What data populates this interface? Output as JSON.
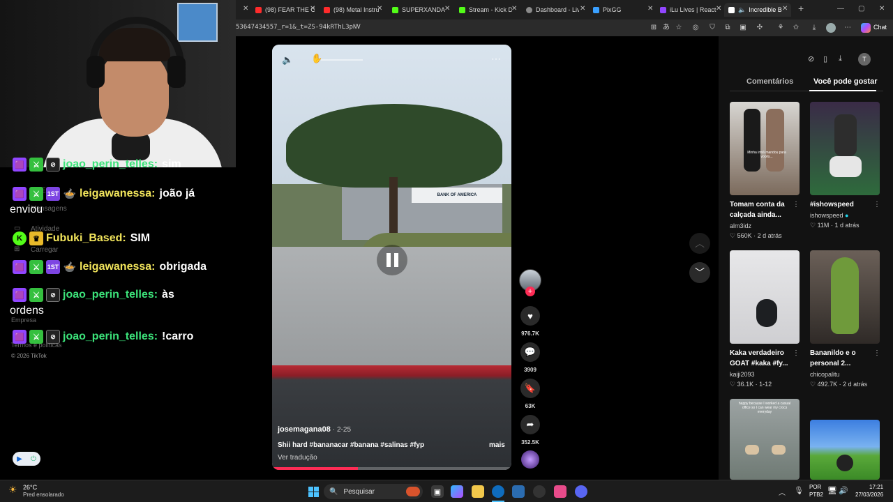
{
  "browser": {
    "tabs": [
      {
        "title": "(98) FEAR THE C",
        "color": "#ff2b2b"
      },
      {
        "title": "(98) Metal Instru",
        "color": "#ff2b2b"
      },
      {
        "title": "SUPERXANDAO",
        "color": "#53fc18"
      },
      {
        "title": "Stream - Kick Da",
        "color": "#53fc18"
      },
      {
        "title": "Dashboard - Liv",
        "color": "#8a8a8a"
      },
      {
        "title": "PixGG",
        "color": "#3aa0ff"
      },
      {
        "title": "iLu Lives | React",
        "color": "#9146ff"
      },
      {
        "title": "Incredible B",
        "color": "#ffffff"
      }
    ],
    "url": "53647434557_r=1&_t=ZS-94kRThL3pNV",
    "copilot_label": "Chat"
  },
  "tiktok_left": {
    "items": [
      "Mensagens",
      "Atividade",
      "Carregar",
      "Empresa",
      "Termos e políticas"
    ],
    "copyright": "© 2026 TikTok"
  },
  "chat": [
    {
      "badges": [
        "twitch",
        "sword",
        "mod"
      ],
      "user": "joao_perin_telles:",
      "color": "#3ce37a",
      "text": "sim"
    },
    {
      "badges": [
        "twitch",
        "sword",
        "first",
        "bowl"
      ],
      "user": "leigawanessa:",
      "color": "#f2e55c",
      "text": "joão já",
      "wrap": "enviou"
    },
    {
      "badges": [
        "kick",
        "crown"
      ],
      "user": "Fubuki_Based:",
      "color": "#f2e55c",
      "text": "SIM"
    },
    {
      "badges": [
        "twitch",
        "sword",
        "first",
        "bowl"
      ],
      "user": "leigawanessa:",
      "color": "#f2e55c",
      "text": "obrigada"
    },
    {
      "badges": [
        "twitch",
        "sword",
        "mod"
      ],
      "user": "joao_perin_telles:",
      "color": "#3ce37a",
      "text": "às",
      "wrap": "ordens"
    },
    {
      "badges": [
        "twitch",
        "sword",
        "mod"
      ],
      "user": "joao_perin_telles:",
      "color": "#3ce37a",
      "text": "!carro"
    }
  ],
  "video": {
    "author": "josemagana08",
    "date": "· 2-25",
    "caption": "Shii hard #bananacar #banana #salinas #fyp",
    "more": "mais",
    "translate": "Ver tradução",
    "sign_text": "BANK OF AMERICA",
    "progress": 0.36
  },
  "actions": {
    "likes": "976.7K",
    "comments": "3909",
    "saves": "63K",
    "shares": "352.5K"
  },
  "sidebar": {
    "tabs": [
      "Comentários",
      "Você pode gostar"
    ],
    "active_tab": "Você pode gostar",
    "cards": [
      {
        "title": "Tomam conta da calçada ainda...",
        "user": "alm3idz",
        "verified": false,
        "likes": "560K",
        "age": "2 d atrás",
        "thumb_caption": "Minha irmã mandou para vocês..."
      },
      {
        "title": "#ishowspeed",
        "user": "ishowspeed",
        "verified": true,
        "likes": "11M",
        "age": "1 d atrás"
      },
      {
        "title": "Kaka verdadeiro GOAT #kaka #fy...",
        "user": "kaiji2093",
        "verified": false,
        "likes": "36.1K",
        "age": "1-12"
      },
      {
        "title": "Bananildo e o personal 2...",
        "user": "chicopalitu",
        "verified": false,
        "likes": "492.7K",
        "age": "2 d atrás"
      },
      {
        "title": "",
        "user": "",
        "verified": false,
        "likes": "",
        "age": "",
        "thumb_caption": "happy because I worked a casual office so I can wear my crocs everyday"
      },
      {
        "title": "",
        "user": "",
        "verified": false,
        "likes": "",
        "age": ""
      }
    ]
  },
  "taskbar": {
    "weather_temp": "26°C",
    "weather_desc": "Pred ensolarado",
    "search_placeholder": "Pesquisar",
    "lang": "POR",
    "layout": "PTB2",
    "time": "17:21",
    "date": "27/03/2026"
  }
}
